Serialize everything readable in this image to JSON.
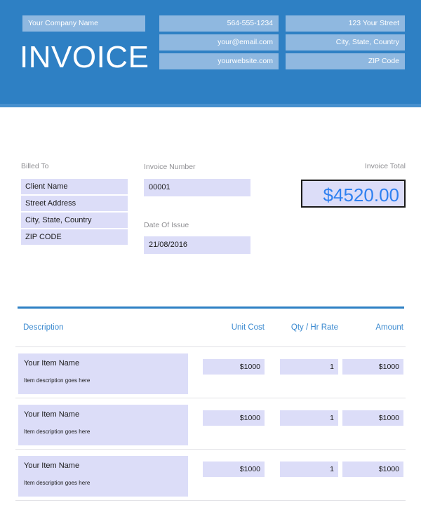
{
  "header": {
    "company_name": "Your Company Name",
    "title": "INVOICE",
    "contact_left": [
      "564-555-1234",
      "your@email.com",
      "yourwebsite.com"
    ],
    "contact_right": [
      "123 Your Street",
      "City, State, Country",
      "ZIP Code"
    ],
    "background_color": "#2E80C4",
    "field_color": "#8FB8E0"
  },
  "billing": {
    "billed_to_label": "Billed To",
    "billed_to_fields": [
      "Client Name",
      "Street Address",
      "City, State, Country",
      "ZIP CODE"
    ],
    "invoice_number_label": "Invoice Number",
    "invoice_number_value": "00001",
    "date_of_issue_label": "Date Of Issue",
    "date_of_issue_value": "21/08/2016",
    "invoice_total_label": "Invoice Total",
    "invoice_total_value": "$4520.00",
    "total_color": "#2E80F0",
    "field_color": "#DCDDF8"
  },
  "table": {
    "columns": {
      "description": "Description",
      "unit_cost": "Unit Cost",
      "qty_hr_rate": "Qty / Hr Rate",
      "amount": "Amount"
    },
    "header_color": "#3b8ad0",
    "rows": [
      {
        "name": "Your Item Name",
        "description": "Item description goes here",
        "unit_cost": "$1000",
        "qty": "1",
        "amount": "$1000"
      },
      {
        "name": "Your Item Name",
        "description": "Item description goes here",
        "unit_cost": "$1000",
        "qty": "1",
        "amount": "$1000"
      },
      {
        "name": "Your Item Name",
        "description": "Item description goes here",
        "unit_cost": "$1000",
        "qty": "1",
        "amount": "$1000"
      }
    ]
  }
}
